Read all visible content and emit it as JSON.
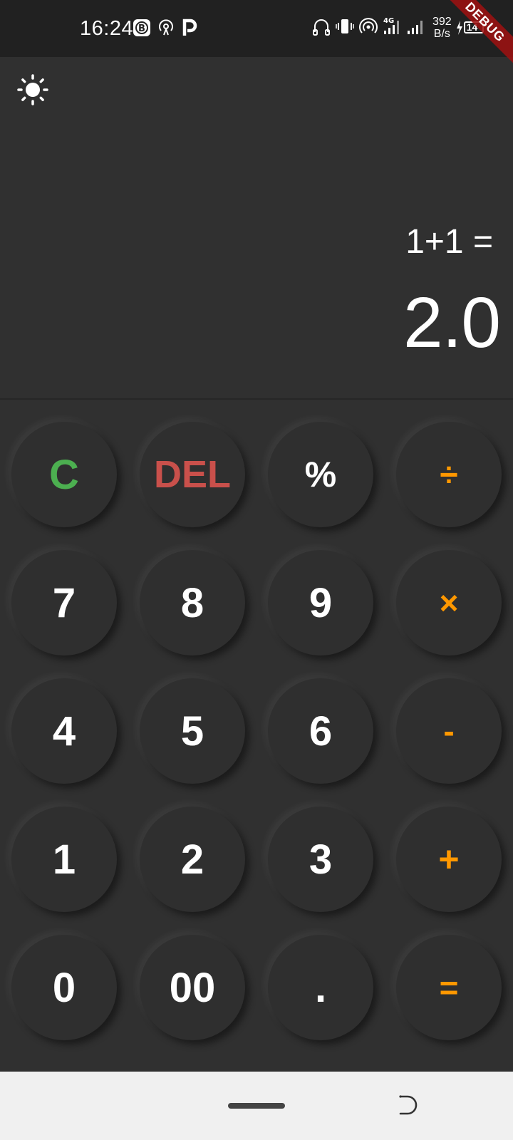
{
  "status_bar": {
    "time": "16:24",
    "network_speed_value": "392",
    "network_speed_unit": "B/s",
    "network_type": "4G",
    "battery_level": "14",
    "left_icons": [
      "b-circle-icon",
      "hotspot-icon",
      "p-icon"
    ],
    "right_icons": [
      "headphones-icon",
      "vibrate-icon",
      "wifi-hotspot-icon",
      "signal-4g-icon",
      "signal-icon",
      "charging-icon",
      "battery-icon"
    ]
  },
  "debug_banner": "DEBUG",
  "display": {
    "theme_icon": "sun-icon",
    "expression": "1+1 =",
    "result": "2.0"
  },
  "keypad": {
    "keys": [
      {
        "label": "C",
        "color": "#4caf50"
      },
      {
        "label": "DEL",
        "color": "#c9504b"
      },
      {
        "label": "%",
        "color": "#ffffff"
      },
      {
        "label": "÷",
        "color": "#ff9800"
      },
      {
        "label": "7",
        "color": "#ffffff"
      },
      {
        "label": "8",
        "color": "#ffffff"
      },
      {
        "label": "9",
        "color": "#ffffff"
      },
      {
        "label": "×",
        "color": "#ff9800"
      },
      {
        "label": "4",
        "color": "#ffffff"
      },
      {
        "label": "5",
        "color": "#ffffff"
      },
      {
        "label": "6",
        "color": "#ffffff"
      },
      {
        "label": "-",
        "color": "#ff9800"
      },
      {
        "label": "1",
        "color": "#ffffff"
      },
      {
        "label": "2",
        "color": "#ffffff"
      },
      {
        "label": "3",
        "color": "#ffffff"
      },
      {
        "label": "+",
        "color": "#ff9800"
      },
      {
        "label": "0",
        "color": "#ffffff"
      },
      {
        "label": "00",
        "color": "#ffffff"
      },
      {
        "label": ".",
        "color": "#ffffff"
      },
      {
        "label": "=",
        "color": "#ff9800"
      }
    ]
  },
  "nav_bar": {
    "home_icon": "home-pill-icon",
    "back_icon": "back-icon"
  },
  "colors": {
    "background": "#303030",
    "status_bar": "#212121",
    "accent_operator": "#ff9800",
    "clear": "#4caf50",
    "delete": "#c9504b"
  }
}
